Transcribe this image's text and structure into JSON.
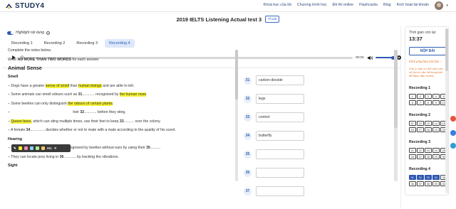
{
  "brand": {
    "name": "STUDY4"
  },
  "nav": {
    "links": [
      "Khoá học của tôi",
      "Chương trình học",
      "Đề thi online",
      "Flashcards",
      "Blog",
      "Kích hoạt tài khoản"
    ]
  },
  "test": {
    "title": "2019 IELTS Listening Actual test 3",
    "exit_label": "Thoát"
  },
  "toolbar": {
    "highlight_label": "Highlight nội dung",
    "info": "i"
  },
  "tabs": [
    "Recording 1",
    "Recording 2",
    "Recording 3",
    "Recording 4"
  ],
  "active_tab": 3,
  "player": {
    "time": "00:00",
    "progress": 0,
    "volume": 1.0
  },
  "passage": {
    "instr1": "Complete the notes below.",
    "instr2_pre": "Write ",
    "instr2_bold": "NO MORE THAN TWO WORDS",
    "instr2_post": " for each answer.",
    "heading": "Animal Sense",
    "smell": "Smell",
    "l1a": "– Dogs have a greater ",
    "l1b": "sense of smell",
    "l1c": " than ",
    "l1d": "human beings",
    "l1e": " and are able to tell.",
    "l2a": "– Some animals can smell odours such as ",
    "l2n": "31",
    "l2b": "............ recognised by ",
    "l2c": "the human nose",
    "l2d": ".",
    "l3a": "– Some beetles can only distinguish ",
    "l3b": "the odours of certain plants",
    "l3c": ".",
    "l4a": "– ",
    "l4b": "heir ",
    "l4n": "32",
    "l4c": "............ before they sting.",
    "l5a": "– ",
    "l5b": "Queen bees",
    "l5c": ", which can sting multiple times, use their feet to keep ",
    "l5n": "33",
    "l5d": ".......... over the colony.",
    "l6a": "– A female ",
    "l6n": "34",
    "l6b": ".............. decides whether or not to mate with a male according to the quality of his scent.",
    "hearing": "Hearing",
    "l7a": "– Sound through vibrations can be recognized by beetles without ears by using their ",
    "l7n": "35",
    "l7b": "..........",
    "l8a": "– They can locate prey living in ",
    "l8n": "36",
    "l8b": "............ by tracking the vibrations.",
    "sight": "Sight"
  },
  "formatting_bar": {
    "swatches": [
      "#f5f233",
      "#f48bb8",
      "#8fd3f5",
      "#b4ef9c",
      "#f7c56d"
    ],
    "icons": [
      "✎",
      "A/c",
      "✕"
    ]
  },
  "answers": [
    {
      "num": "31",
      "value": "carbon dioxide"
    },
    {
      "num": "32",
      "value": "legs"
    },
    {
      "num": "33",
      "value": "control"
    },
    {
      "num": "34",
      "value": "butterfly"
    },
    {
      "num": "35",
      "value": ""
    },
    {
      "num": "36",
      "value": ""
    },
    {
      "num": "37",
      "value": ""
    }
  ],
  "sidebar": {
    "time_label": "Thời gian còn lại:",
    "time_value": "13:37",
    "submit_label": "NỘP BÀI",
    "restore_label": "Khôi phục/lưu bài làm ›",
    "note": "Chú ý: bạn có thể click vào số thứ tự câu hỏi trong bài để đánh dấu review",
    "recordings": [
      {
        "title": "Recording 1",
        "start": 1,
        "count": 10,
        "done_count": 0
      },
      {
        "title": "Recording 2",
        "start": 11,
        "count": 10,
        "done_count": 0
      },
      {
        "title": "Recording 3",
        "start": 21,
        "count": 10,
        "done_count": 0
      },
      {
        "title": "Recording 4",
        "start": 31,
        "count": 10,
        "done_count": 4
      }
    ]
  },
  "colors": {
    "accent": "#2f57b3",
    "highlight": "#f5f233",
    "warning": "#e0762a"
  }
}
